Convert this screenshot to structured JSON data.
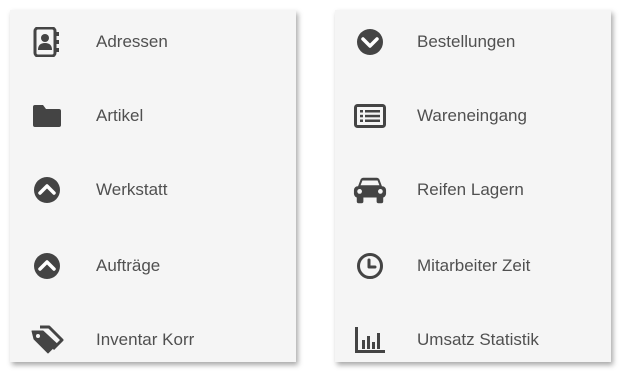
{
  "menu_left": {
    "items": [
      {
        "label": "Adressen",
        "icon": "address-book-icon"
      },
      {
        "label": "Artikel",
        "icon": "folder-icon"
      },
      {
        "label": "Werkstatt",
        "icon": "chevron-up-circle-icon"
      },
      {
        "label": "Aufträge",
        "icon": "chevron-up-circle-icon"
      },
      {
        "label": "Inventar Korr",
        "icon": "tags-icon"
      }
    ]
  },
  "menu_right": {
    "items": [
      {
        "label": "Bestellungen",
        "icon": "chevron-down-circle-icon"
      },
      {
        "label": "Wareneingang",
        "icon": "list-icon"
      },
      {
        "label": "Reifen Lagern",
        "icon": "car-icon"
      },
      {
        "label": "Mitarbeiter Zeit",
        "icon": "clock-icon"
      },
      {
        "label": "Umsatz Statistik",
        "icon": "bar-chart-icon"
      }
    ]
  },
  "colors": {
    "icon": "#444444",
    "text": "#505050",
    "panel": "#f5f5f5"
  }
}
